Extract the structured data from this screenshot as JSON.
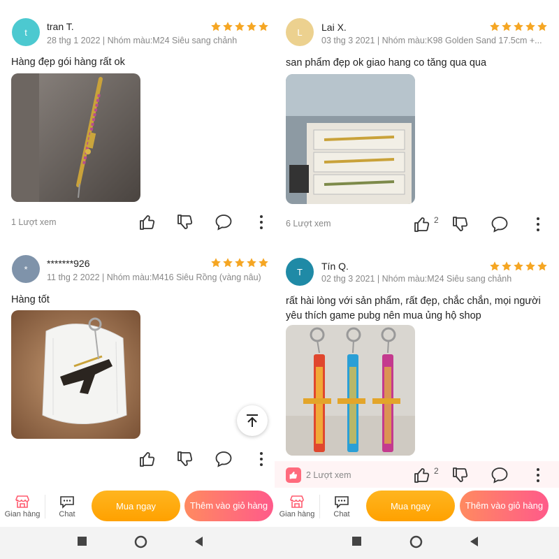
{
  "left": {
    "reviews": [
      {
        "avatar_letter": "t",
        "avatar_color": "#4cc9d0",
        "username": "tran T.",
        "meta": "28 thg 1 2022 | Nhóm màu:M24 Siêu sang chảnh",
        "stars": 5,
        "comment": "Hàng đẹp gói hàng rất ok",
        "views": "1 Lượt xem",
        "like_count": ""
      },
      {
        "avatar_letter": "*",
        "avatar_color": "#7f93aa",
        "username": "*******926",
        "meta": "11 thg 2 2022 | Nhóm màu:M416 Siêu Rồng (vàng nâu)",
        "stars": 5,
        "comment": "Hàng tốt",
        "views": "",
        "like_count": ""
      }
    ]
  },
  "right": {
    "reviews": [
      {
        "avatar_letter": "L",
        "avatar_color": "#ecd18f",
        "username": "Lai X.",
        "meta": "03 thg 3 2021 | Nhóm màu:K98 Golden Sand 17.5cm +...",
        "stars": 5,
        "comment": "san phẩm đẹp ok giao hang co tăng qua qua",
        "views": "6 Lượt xem",
        "like_count": "2"
      },
      {
        "avatar_letter": "T",
        "avatar_color": "#1f8aa6",
        "username": "Tín Q.",
        "meta": "02 thg 3 2021 | Nhóm màu:M24 Siêu sang chảnh",
        "stars": 5,
        "comment": "rất hài lòng với sản phẩm, rất đẹp, chắc chắn, mọi người yêu thích game pubg nên mua ủng hộ shop",
        "views": "2 Lượt xem",
        "like_count": "2"
      }
    ]
  },
  "bottombar": {
    "store_label": "Gian hàng",
    "chat_label": "Chat",
    "buy_now_label": "Mua ngay",
    "add_to_cart_label": "Thêm vào giỏ hàng"
  },
  "colors": {
    "star": "#f5a623",
    "buy_now": "#ffa100",
    "add_to_cart": "#ff5a8a",
    "like_bar": "#fff4f5"
  }
}
